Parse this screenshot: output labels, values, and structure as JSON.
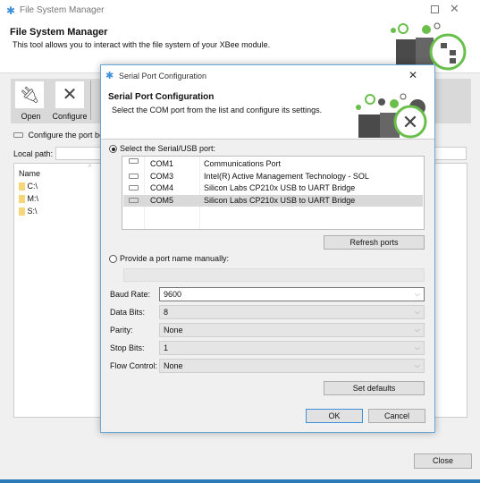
{
  "main": {
    "title": "File System Manager",
    "header_title": "File System Manager",
    "header_subtitle": "This tool allows you to interact with the file system of your XBee module.",
    "toolbar": {
      "open": "Open",
      "configure": "Configure"
    },
    "status": "Configure the port be",
    "local_path_label": "Local path:",
    "list_header": "Name",
    "items": [
      "C:\\",
      "M:\\",
      "S:\\"
    ],
    "close": "Close"
  },
  "dialog": {
    "title": "Serial Port Configuration",
    "header_title": "Serial Port Configuration",
    "header_subtitle": "Select the COM port from the list and configure its settings.",
    "select_radio": "Select the Serial/USB port:",
    "ports": [
      {
        "port": "COM1",
        "desc": "Communications Port"
      },
      {
        "port": "COM3",
        "desc": "Intel(R) Active Management Technology - SOL"
      },
      {
        "port": "COM4",
        "desc": "Silicon Labs CP210x USB to UART Bridge"
      },
      {
        "port": "COM5",
        "desc": "Silicon Labs CP210x USB to UART Bridge",
        "selected": true
      }
    ],
    "refresh": "Refresh ports",
    "manual_radio": "Provide a port name manually:",
    "manual_value": "",
    "fields": [
      {
        "label": "Baud Rate:",
        "value": "9600"
      },
      {
        "label": "Data Bits:",
        "value": "8"
      },
      {
        "label": "Parity:",
        "value": "None"
      },
      {
        "label": "Stop Bits:",
        "value": "1"
      },
      {
        "label": "Flow Control:",
        "value": "None"
      }
    ],
    "set_defaults": "Set defaults",
    "ok": "OK",
    "cancel": "Cancel"
  },
  "colors": {
    "accent": "#6abf4b",
    "focus": "#3c8fd8",
    "dark_icon": "#4a4a4a"
  }
}
